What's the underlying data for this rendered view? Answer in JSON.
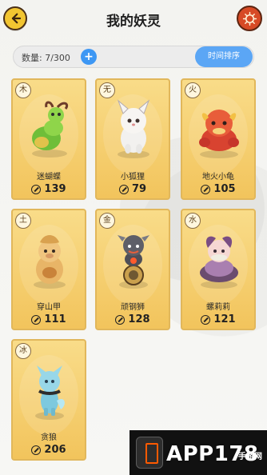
{
  "header": {
    "title": "我的妖灵",
    "back_icon": "back-arrow-icon",
    "settings_icon": "refresh-gear-icon"
  },
  "toolbar": {
    "count_label": "数量: 7/300",
    "add_label": "+",
    "sort_label": "时间排序"
  },
  "cards": [
    {
      "element": "木",
      "name": "迷蝴蝶",
      "power": "139",
      "icon": "butterfly-creature-icon"
    },
    {
      "element": "无",
      "name": "小狐狸",
      "power": "79",
      "icon": "fox-creature-icon"
    },
    {
      "element": "火",
      "name": "地火小龟",
      "power": "105",
      "icon": "turtle-creature-icon"
    },
    {
      "element": "土",
      "name": "穿山甲",
      "power": "111",
      "icon": "pangolin-creature-icon"
    },
    {
      "element": "金",
      "name": "顽钢狮",
      "power": "128",
      "icon": "lion-creature-icon"
    },
    {
      "element": "水",
      "name": "螺莉莉",
      "power": "121",
      "icon": "snail-creature-icon"
    },
    {
      "element": "冰",
      "name": "贪狼",
      "power": "206",
      "icon": "wolf-creature-icon"
    }
  ],
  "watermark": {
    "brand": "APP178",
    "site": "手游网"
  },
  "colors": {
    "accent_blue": "#5ba6f5",
    "card_gold": "#f2c45c",
    "header_yellow": "#f2c531",
    "header_red": "#d74a25"
  }
}
